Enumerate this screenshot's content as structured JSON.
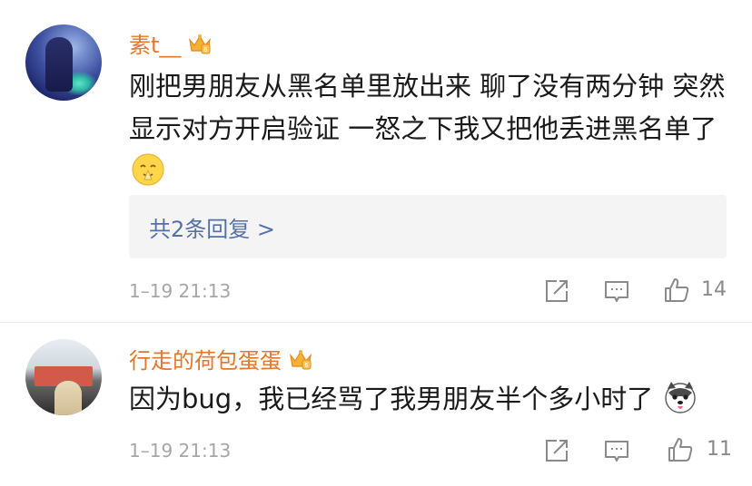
{
  "comments": [
    {
      "user": "素t__",
      "text": "刚把男朋友从黑名单里放出来 聊了没有两分钟 突然显示对方开启验证 一怒之下我又把他丢进黑名单了",
      "emoji": "pray-smile-emoji",
      "replies_label": "共2条回复 >",
      "timestamp": "1–19 21:13",
      "likes": "14"
    },
    {
      "user": "行走的荷包蛋蛋",
      "text": "因为bug，我已经骂了我男朋友半个多小时了",
      "emoji": "husky-dog-emoji",
      "timestamp": "1–19 21:13",
      "likes": "11"
    }
  ],
  "colors": {
    "username": "#e0772c",
    "reply_link": "#5471a6",
    "meta": "#a6a6a6",
    "reply_bg": "#f4f4f4"
  },
  "icons": [
    "crown-badge-icon",
    "share-icon",
    "comment-icon",
    "like-icon"
  ]
}
